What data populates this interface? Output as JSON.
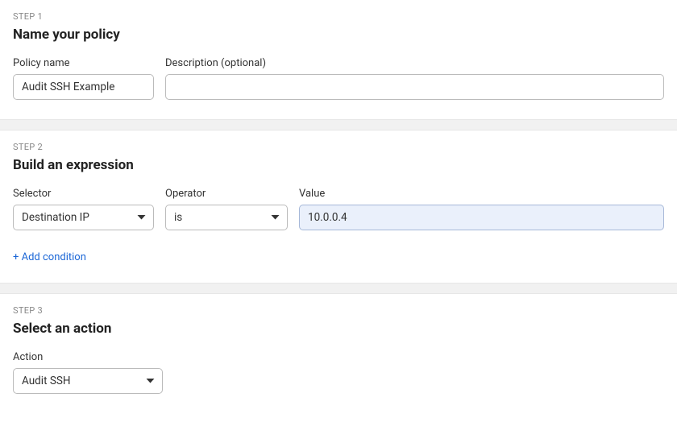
{
  "step1": {
    "step_label": "STEP 1",
    "title": "Name your policy",
    "policy_name_label": "Policy name",
    "policy_name_value": "Audit SSH Example",
    "description_label": "Description (optional)",
    "description_value": ""
  },
  "step2": {
    "step_label": "STEP 2",
    "title": "Build an expression",
    "selector_label": "Selector",
    "selector_value": "Destination IP",
    "operator_label": "Operator",
    "operator_value": "is",
    "value_label": "Value",
    "value_value": "10.0.0.4",
    "add_condition_label": "+ Add condition"
  },
  "step3": {
    "step_label": "STEP 3",
    "title": "Select an action",
    "action_label": "Action",
    "action_value": "Audit SSH"
  }
}
